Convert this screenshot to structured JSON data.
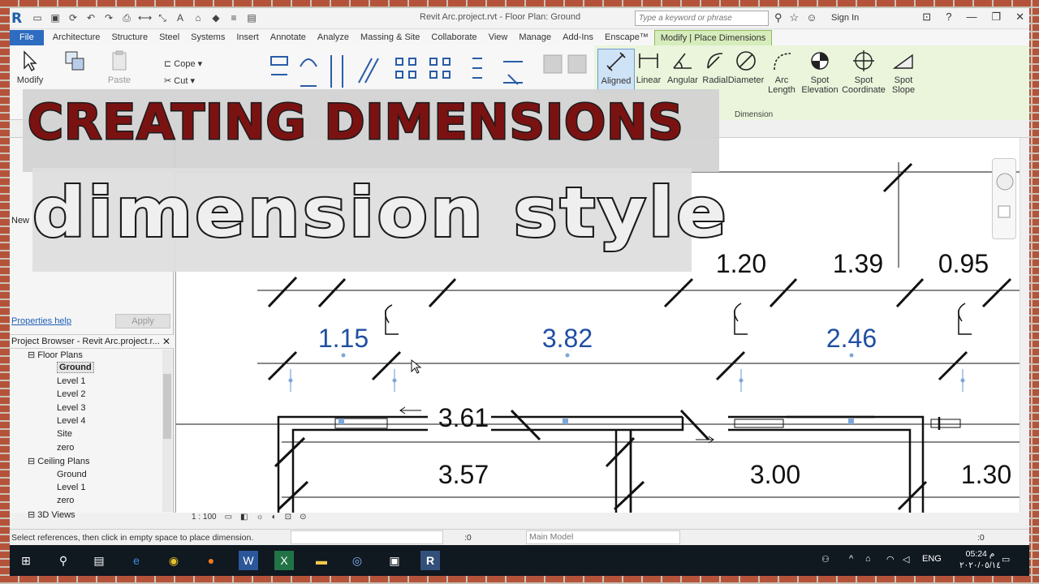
{
  "title_bar": {
    "doc_title": "Revit Arc.project.rvt - Floor Plan: Ground",
    "search_placeholder": "Type a keyword or phrase",
    "sign_in": "Sign In"
  },
  "menu_tabs": [
    "File",
    "Architecture",
    "Structure",
    "Steel",
    "Systems",
    "Insert",
    "Annotate",
    "Analyze",
    "Massing & Site",
    "Collaborate",
    "View",
    "Manage",
    "Add-Ins",
    "Enscape™",
    "Modify | Place Dimensions"
  ],
  "ribbon": {
    "modify": "Modify",
    "paste": "Paste",
    "cope": "Cope",
    "cut": "Cut",
    "dimension_tools": [
      {
        "label": "Aligned",
        "label2": ""
      },
      {
        "label": "Linear",
        "label2": ""
      },
      {
        "label": "Angular",
        "label2": ""
      },
      {
        "label": "Radial",
        "label2": ""
      },
      {
        "label": "Diameter",
        "label2": ""
      },
      {
        "label": "Arc",
        "label2": "Length"
      },
      {
        "label": "Spot",
        "label2": "Elevation"
      },
      {
        "label": "Spot",
        "label2": "Coordinate"
      },
      {
        "label": "Spot",
        "label2": "Slope"
      }
    ],
    "group_dimension": "Dimension"
  },
  "overlay": {
    "headline": "CREATING DIMENSIONS",
    "subheadline": "dimension style"
  },
  "left_panel": {
    "new_label": "New",
    "properties_help": "Properties help",
    "apply": "Apply",
    "project_browser_title": "Project Browser - Revit Arc.project.r...",
    "tree": [
      {
        "label": "Floor Plans",
        "kind": "cat"
      },
      {
        "label": "Ground",
        "kind": "sel"
      },
      {
        "label": "Level 1",
        "kind": "item"
      },
      {
        "label": "Level 2",
        "kind": "item"
      },
      {
        "label": "Level 3",
        "kind": "item"
      },
      {
        "label": "Level 4",
        "kind": "item"
      },
      {
        "label": "Site",
        "kind": "item"
      },
      {
        "label": "zero",
        "kind": "item"
      },
      {
        "label": "Ceiling Plans",
        "kind": "cat"
      },
      {
        "label": "Ground",
        "kind": "item"
      },
      {
        "label": "Level 1",
        "kind": "item"
      },
      {
        "label": "zero",
        "kind": "item"
      },
      {
        "label": "3D Views",
        "kind": "cat"
      }
    ]
  },
  "canvas": {
    "dims_black_top": [
      "1.20",
      "1.39",
      "0.95"
    ],
    "dims_blue": [
      "1.15",
      "3.82",
      "2.46"
    ],
    "dim_wall": "3.61",
    "dims_rooms": [
      "3.57",
      "3.00",
      "1.30"
    ],
    "scale": "1 : 100"
  },
  "status_bar": {
    "message": "Select references, then click in empty space to place dimension.",
    "counter": ":0",
    "model": "Main Model",
    "filter_count": ":0"
  },
  "taskbar": {
    "lang": "ENG",
    "time": "05:24 م",
    "date": "٢٠٢٠/٠٥/١٤"
  },
  "colors": {
    "accent_blue": "#2d6cc0",
    "context_tab": "#d7ecbc",
    "headline_red": "#7b1212",
    "dimension_blue": "#1f4fa3"
  }
}
